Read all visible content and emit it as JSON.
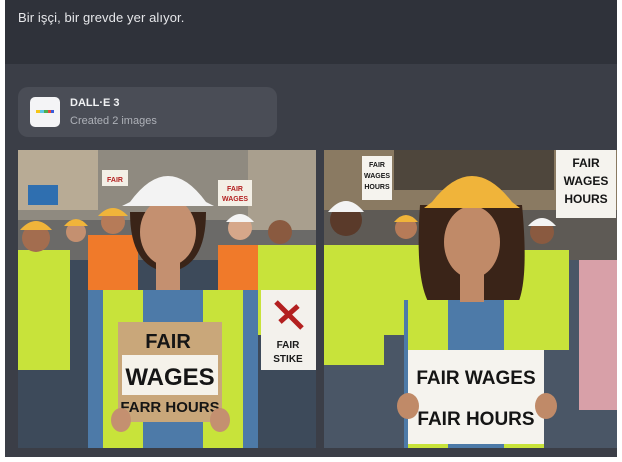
{
  "prompt": {
    "text": "Bir işçi, bir grevde yer alıyor."
  },
  "tool_card": {
    "title": "DALL·E 3",
    "subtitle": "Created 2 images",
    "icon": "dalle-color-bar-icon"
  },
  "images": [
    {
      "signs": {
        "main_1": "FAIR",
        "main_2": "WAGES",
        "main_3": "FARR HOURS",
        "right_1": "FAIR",
        "right_2": "STIKE",
        "top_left": "FAIR",
        "top_center_1": "FAIR",
        "top_center_2": "WAGES"
      }
    },
    {
      "signs": {
        "main_1": "FAIR WAGES",
        "main_2": "FAIR HOURS",
        "left_1": "FAIR",
        "left_2": "WAGES",
        "left_3": "HOURS",
        "right_1": "FAIR",
        "right_2": "WAGES",
        "right_3": "HOURS"
      }
    }
  ],
  "colors": {
    "background": "#3b3e47",
    "prompt_bar": "#2f323a",
    "card": "#4a4d56",
    "vest": "#c8e33a",
    "helmet_yellow": "#f0b43a"
  }
}
